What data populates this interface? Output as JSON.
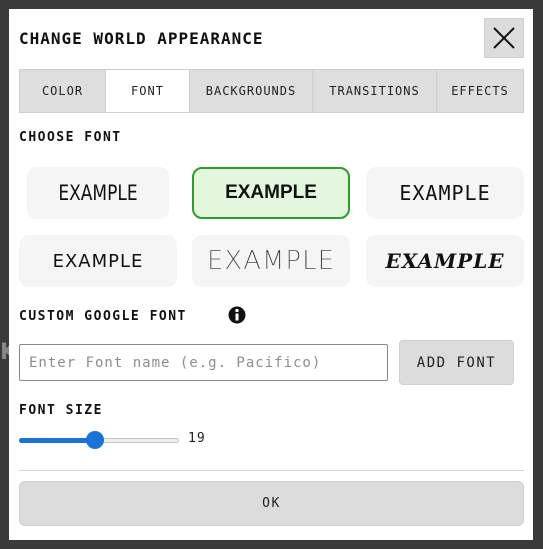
{
  "dialog": {
    "title": "CHANGE WORLD APPEARANCE",
    "close_icon": "close-icon"
  },
  "tabs": [
    {
      "label": "COLOR",
      "active": false
    },
    {
      "label": "FONT",
      "active": true
    },
    {
      "label": "BACKGROUNDS",
      "active": false
    },
    {
      "label": "TRANSITIONS",
      "active": false
    },
    {
      "label": "EFFECTS",
      "active": false
    }
  ],
  "choose_font": {
    "label": "CHOOSE FONT",
    "options": [
      {
        "text": "EXAMPLE",
        "selected": false
      },
      {
        "text": "EXAMPLE",
        "selected": true
      },
      {
        "text": "EXAMPLE",
        "selected": false
      },
      {
        "text": "EXAMPLE",
        "selected": false
      },
      {
        "text": "EXAMPLE",
        "selected": false
      },
      {
        "text": "EXAMPLE",
        "selected": false
      }
    ]
  },
  "custom_font": {
    "label": "CUSTOM GOOGLE FONT",
    "info_icon": "info-icon",
    "placeholder": "Enter Font name (e.g. Pacifico)",
    "value": "",
    "add_label": "ADD FONT"
  },
  "font_size": {
    "label": "FONT SIZE",
    "value": "19",
    "slider_fraction": 0.46
  },
  "ok_label": "OK",
  "colors": {
    "accent": "#1a73d6",
    "selected_border": "#2f9d2a",
    "selected_bg": "#e3f7df"
  }
}
